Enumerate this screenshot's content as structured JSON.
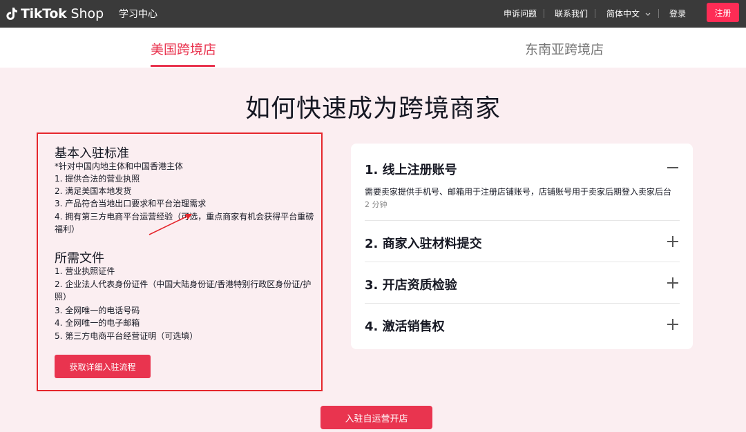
{
  "header": {
    "logo_bold": "TikTok",
    "logo_light": "Shop",
    "learning_center": "学习中心",
    "nav": {
      "appeal": "申诉问题",
      "contact": "联系我们",
      "language": "简体中文",
      "login": "登录",
      "register": "注册"
    }
  },
  "tabs": [
    {
      "label": "美国跨境店",
      "active": true
    },
    {
      "label": "东南亚跨境店",
      "active": false
    }
  ],
  "page_title": "如何快速成为跨境商家",
  "criteria": {
    "title": "基本入驻标准",
    "note": "*针对中国内地主体和中国香港主体",
    "items": [
      "1. 提供合法的营业执照",
      "2. 满足美国本地发货",
      "3. 产品符合当地出口要求和平台治理需求",
      "4. 拥有第三方电商平台运营经验（可选，重点商家有机会获得平台重磅福利）"
    ]
  },
  "documents": {
    "title": "所需文件",
    "items": [
      "1. 营业执照证件",
      "2. 企业法人代表身份证件（中国大陆身份证/香港特别行政区身份证/护照）",
      "3. 全网唯一的电话号码",
      "4. 全网唯一的电子邮箱",
      "5. 第三方电商平台经营证明（可选填）"
    ]
  },
  "detail_button": "获取详细入驻流程",
  "accordion": [
    {
      "title": "1. 线上注册账号",
      "expanded": true,
      "desc": "需要卖家提供手机号、邮箱用于注册店铺账号，店铺账号用于卖家后期登入卖家后台",
      "time": "2 分钟"
    },
    {
      "title": "2. 商家入驻材料提交",
      "expanded": false
    },
    {
      "title": "3. 开店资质检验",
      "expanded": false
    },
    {
      "title": "4. 激活销售权",
      "expanded": false
    }
  ],
  "open_store_button": "入驻自运营开店",
  "colors": {
    "accent": "#e9344f",
    "highlight_border": "#e5262c",
    "topbar": "#3a3a3a"
  }
}
